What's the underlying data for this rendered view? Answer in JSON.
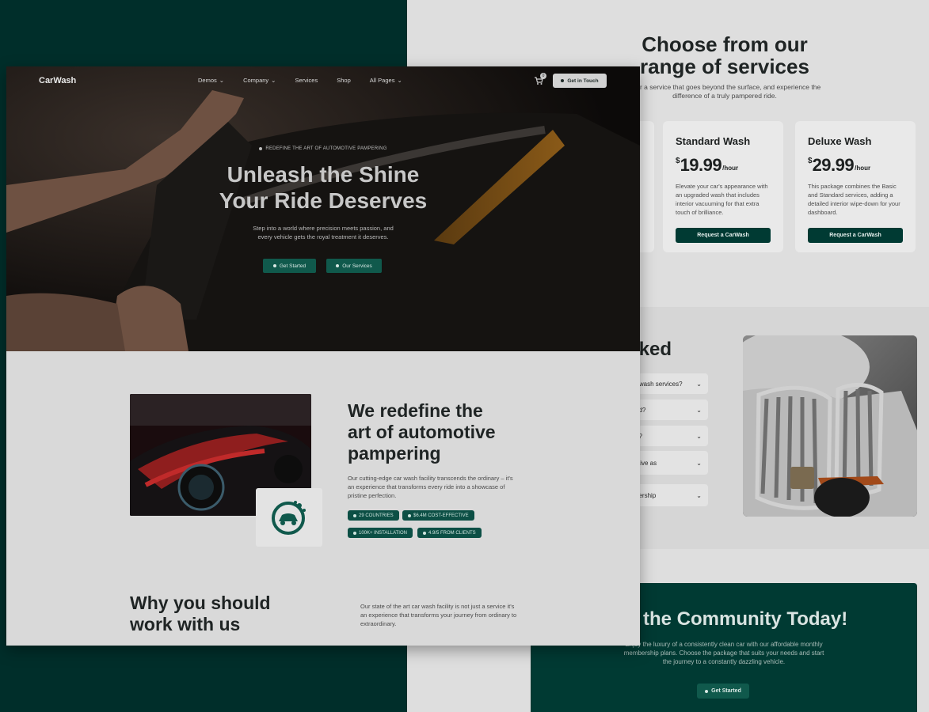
{
  "services": {
    "title_line1": "Choose from our",
    "title_line2": "range of services",
    "subtitle_line1": "n for a service that goes beyond the surface, and experience the",
    "subtitle_line2": "difference of a truly pampered ride.",
    "cards": [
      {
        "name": "Standard Wash",
        "currency": "$",
        "price": "19.99",
        "unit": "/hour",
        "description": "Elevate your car's appearance with an upgraded wash that includes interior vacuuming for that extra touch of brilliance.",
        "button": "Request a CarWash"
      },
      {
        "name": "Deluxe Wash",
        "currency": "$",
        "price": "29.99",
        "unit": "/hour",
        "description": "This package combines the Basic and Standard services, adding a detailed interior wipe-down for your dashboard.",
        "button": "Request a CarWash"
      }
    ]
  },
  "faq": {
    "title": "asked",
    "items": [
      "r wash services?",
      "ed?",
      "e?",
      "ctive as",
      "pership"
    ]
  },
  "community": {
    "title": "the Community Today!",
    "text_line1": "Enjoy the luxury of a consistently clean car with our affordable monthly",
    "text_line2": "membership plans. Choose the package that suits your needs and start",
    "text_line3": "the journey to a constantly dazzling vehicle.",
    "button": "Get Started"
  },
  "front": {
    "nav": {
      "logo": "CarWash",
      "links": [
        "Demos",
        "Company",
        "Services",
        "Shop",
        "All Pages"
      ],
      "cart_count": "0",
      "cta": "Get in Touch"
    },
    "hero": {
      "eyebrow": "REDEFINE THE ART OF AUTOMOTIVE PAMPERING",
      "title_line1": "Unleash the Shine",
      "title_line2": "Your Ride Deserves",
      "sub_line1": "Step into a world where precision meets passion, and",
      "sub_line2": "every vehicle gets the royal treatment it deserves.",
      "btn_primary": "Get Started",
      "btn_secondary": "Our Services"
    },
    "about": {
      "title_line1": "We redefine the",
      "title_line2": "art of automotive",
      "title_line3": "pampering",
      "text": "Our cutting-edge car wash facility transcends the ordinary – it's an experience that transforms every ride into a showcase of pristine perfection.",
      "stats": [
        "29 COUNTRIES",
        "$6.4M COST-EFFECTIVE",
        "100K+ INSTALLATION",
        "4.9/5 FROM CLIENTS"
      ]
    },
    "why": {
      "title_line1": "Why you should",
      "title_line2": "work with us",
      "text": "Our state of the art car wash facility is not just a service it's an experience that transforms your journey from ordinary to extraordinary."
    }
  },
  "colors": {
    "brand_dark": "#002e2a",
    "accent": "#10594c",
    "page_bg": "#d9d9d9"
  }
}
